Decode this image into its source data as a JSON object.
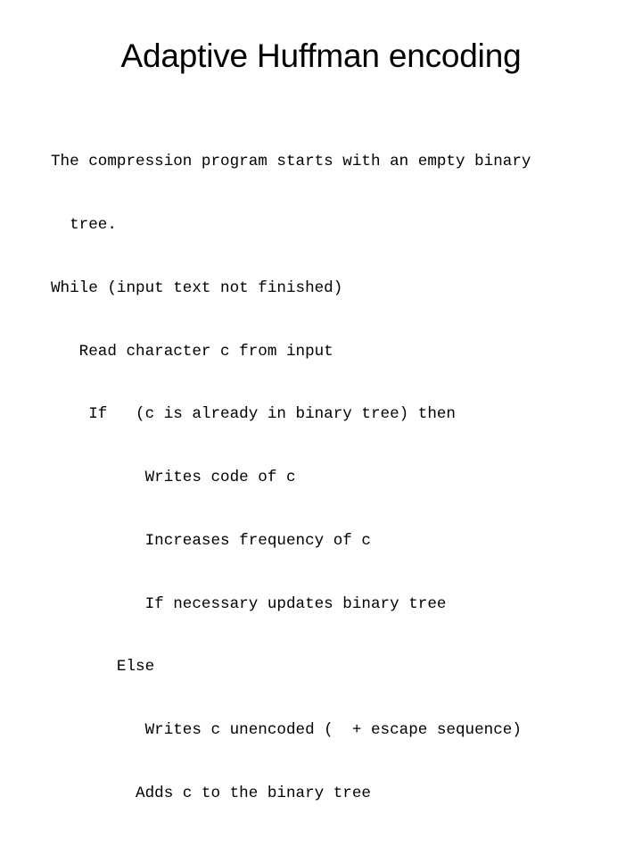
{
  "slide": {
    "title": "Adaptive Huffman encoding",
    "background_color": "#ffffff",
    "text_color": "#000000",
    "body_lines": [
      "The compression program starts with an empty binary",
      "  tree.",
      "While (input text not finished)",
      "   Read character c from input",
      "    If   (c is already in binary tree) then",
      "          Writes code of c",
      "          Increases frequency of c",
      "          If necessary updates binary tree",
      "       Else",
      "          Writes c unencoded (  + escape sequence)",
      "         Adds c to the binary tree"
    ]
  }
}
